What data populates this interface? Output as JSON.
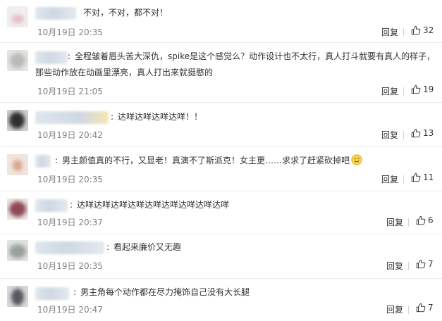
{
  "comments": [
    {
      "text": "不对，不对，都不对！",
      "time": "10月19日 20:35",
      "reply_label": "回复",
      "likes": "32"
    },
    {
      "text_line1": "全程皱着眉头苦大深仇，spike是这个感觉么？动作设计也不太行，真人打斗就要有真人的样子，",
      "text_line2": "那些动作放在动画里漂亮，真人打出来就挺憨的",
      "time": "10月19日 21:05",
      "reply_label": "回复",
      "likes": "19"
    },
    {
      "text": "达咩达咩达咩达咩！！",
      "time": "10月19日 20:42",
      "reply_label": "回复",
      "likes": "13"
    },
    {
      "text": "男主颜值真的不行，又显老！真演不了斯派克！女主更……求求了赶紧砍掉吧",
      "emoji": "smile-emoji",
      "time": "10月19日 20:35",
      "reply_label": "回复",
      "likes": "11"
    },
    {
      "text": "达咩达咩达咩达咩达咩达咩达咩达咩达咩",
      "time": "10月19日 20:37",
      "reply_label": "回复",
      "likes": "6"
    },
    {
      "text": "看起来廉价又无趣",
      "time": "10月19日 20:35",
      "reply_label": "回复",
      "likes": "7"
    },
    {
      "text": "男主角每个动作都在尽力掩饰自己没有大长腿",
      "time": "10月19日 20:47",
      "reply_label": "回复",
      "likes": "7"
    }
  ],
  "icons": {
    "like": "thumbs-up-icon"
  },
  "colors": {
    "text": "#333333",
    "time": "#808080",
    "divider": "#ededed"
  }
}
